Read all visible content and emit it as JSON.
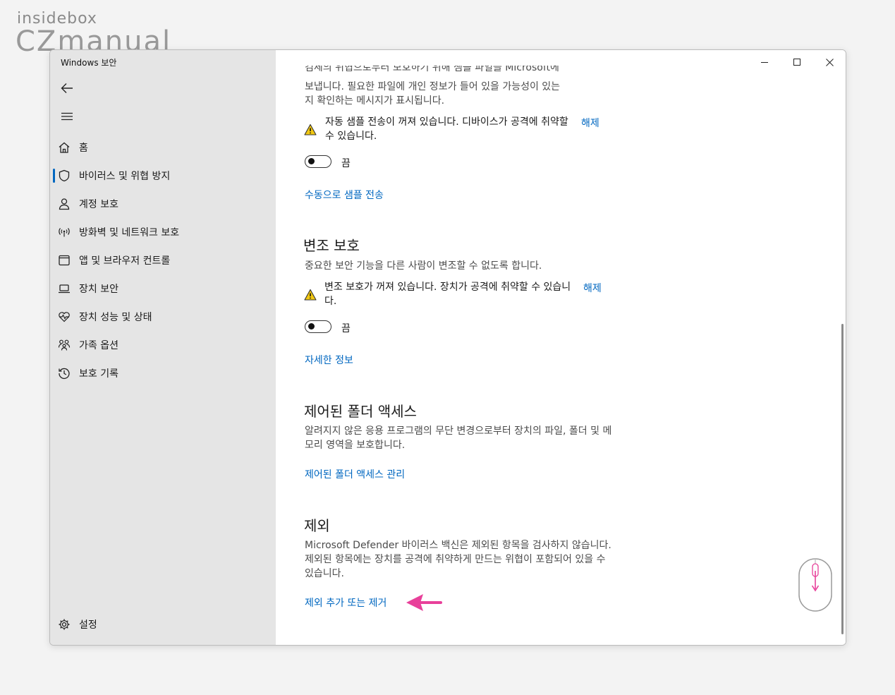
{
  "watermark": {
    "line1": "insidebox",
    "line2": "CZmanual"
  },
  "window": {
    "title": "Windows 보안"
  },
  "sidebar": {
    "items": [
      {
        "label": "홈",
        "icon": "home-icon"
      },
      {
        "label": "바이러스 및 위협 방지",
        "icon": "shield-icon",
        "active": true
      },
      {
        "label": "계정 보호",
        "icon": "person-icon"
      },
      {
        "label": "방화벽 및 네트워크 보호",
        "icon": "wireless-icon"
      },
      {
        "label": "앱 및 브라우저 컨트롤",
        "icon": "app-window-icon"
      },
      {
        "label": "장치 보안",
        "icon": "laptop-icon"
      },
      {
        "label": "장치 성능 및 상태",
        "icon": "heart-pulse-icon"
      },
      {
        "label": "가족 옵션",
        "icon": "family-icon"
      },
      {
        "label": "보호 기록",
        "icon": "history-icon"
      }
    ],
    "settings_label": "설정"
  },
  "main": {
    "top_partial_line": "검체의 위협으로부터 보호하기 위해 샘플 파일을 Microsoft에",
    "top_desc_line2": "보냅니다. 필요한 파일에 개인 정보가 들어 있을 가능성이 있는",
    "top_desc_line3": "지 확인하는 메시지가 표시됩니다.",
    "sample_warning": "자동 샘플 전송이 꺼져 있습니다. 디바이스가 공격에 취약할 수 있습니다.",
    "sample_dismiss": "해제",
    "sample_toggle_label": "끔",
    "manual_sample_link": "수동으로 샘플 전송",
    "tamper": {
      "title": "변조 보호",
      "desc": "중요한 보안 기능을 다른 사람이 변조할 수 없도록 합니다.",
      "warning": "변조 보호가 꺼져 있습니다. 장치가 공격에 취약할 수 있습니다.",
      "dismiss": "해제",
      "toggle_label": "끔",
      "link": "자세한 정보"
    },
    "cfa": {
      "title": "제어된 폴더 액세스",
      "desc": "알려지지 않은 응용 프로그램의 무단 변경으로부터 장치의 파일, 폴더 및 메모리 영역을 보호합니다.",
      "link": "제어된 폴더 액세스 관리"
    },
    "exclusions": {
      "title": "제외",
      "desc": "Microsoft Defender 바이러스 백신은 제외된 항목을 검사하지 않습니다. 제외된 항목에는 장치를 공격에 취약하게 만드는 위협이 포함되어 있을 수 있습니다.",
      "link": "제외 추가 또는 제거"
    }
  },
  "colors": {
    "accent": "#0067c0",
    "sidebar_bg": "#e5e5e5",
    "warning": "#f2c811",
    "annotation": "#e8409a"
  }
}
